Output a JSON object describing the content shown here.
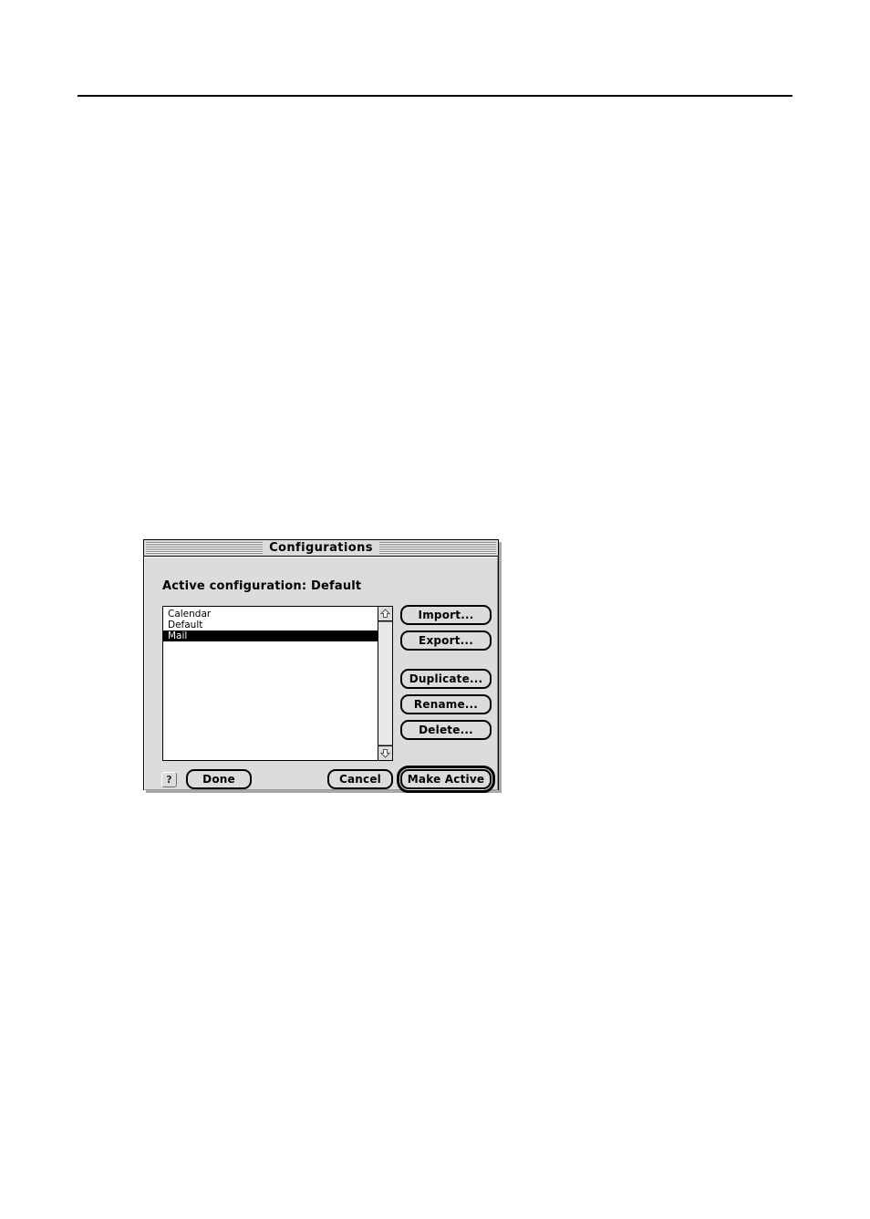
{
  "page": {
    "rule": "horizontal-rule"
  },
  "dialog": {
    "title": "Configurations",
    "active_config_label": "Active configuration: Default",
    "list": {
      "items": [
        {
          "label": "Calendar",
          "selected": false
        },
        {
          "label": "Default",
          "selected": false
        },
        {
          "label": "Mail",
          "selected": true
        }
      ],
      "scroll_up_icon": "scroll-up-arrow-icon",
      "scroll_down_icon": "scroll-down-arrow-icon"
    },
    "side_buttons": [
      {
        "label": "Import...",
        "name": "import-button"
      },
      {
        "label": "Export...",
        "name": "export-button"
      },
      {
        "label": "Duplicate...",
        "name": "duplicate-button"
      },
      {
        "label": "Rename...",
        "name": "rename-button"
      },
      {
        "label": "Delete...",
        "name": "delete-button"
      }
    ],
    "bottom_buttons": {
      "help": "?",
      "done": "Done",
      "cancel": "Cancel",
      "make_active": "Make Active"
    },
    "colors": {
      "window_face": "#dcdcdc",
      "list_background": "#ffffff",
      "selection": "#000000",
      "border": "#000000"
    }
  }
}
